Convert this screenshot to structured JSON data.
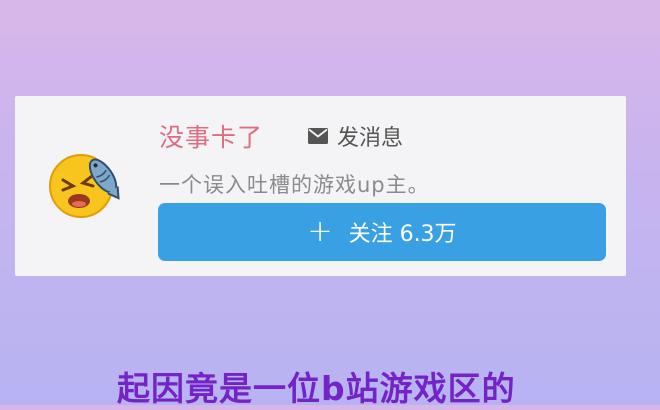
{
  "profile": {
    "username": "没事卡了",
    "message_label": "发消息",
    "bio": "一个误入吐槽的游戏up主。",
    "follow_plus": "+",
    "follow_label": "关注 6.3万"
  },
  "caption": "起因竟是一位b站游戏区的",
  "colors": {
    "username": "#e06c82",
    "follow_button": "#39a0e3",
    "caption": "#7424c6",
    "card_bg": "#f4f4f6"
  },
  "icons": {
    "avatar": "emoji-with-fish-avatar",
    "message": "mail-icon"
  }
}
